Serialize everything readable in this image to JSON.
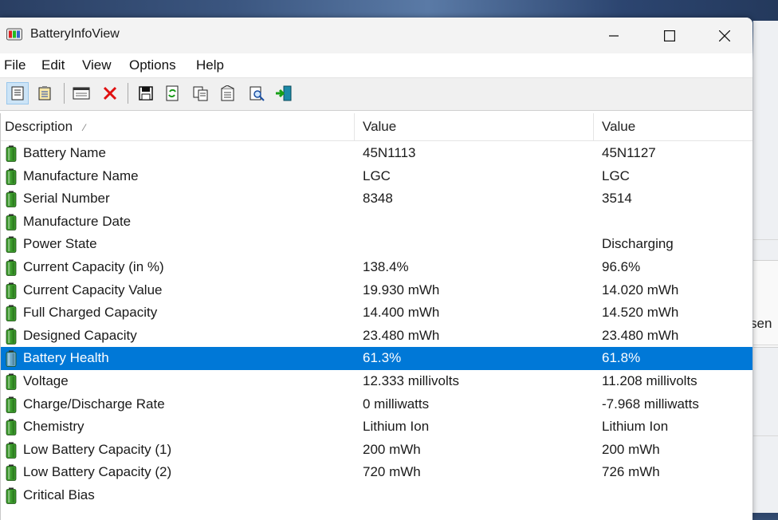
{
  "window": {
    "title": "BatteryInfoView",
    "controls": {
      "minimize": "—",
      "maximize": "☐",
      "close": "✕"
    }
  },
  "menu": [
    "File",
    "Edit",
    "View",
    "Options",
    "Help"
  ],
  "toolbar": [
    "html-report-all-icon",
    "html-report-selected-icon",
    "properties-window-icon",
    "delete-icon",
    "save-icon",
    "refresh-icon",
    "copy-icon",
    "properties-icon",
    "find-icon",
    "exit-icon"
  ],
  "columns": [
    "Description",
    "Value",
    "Value"
  ],
  "sort_indicator": "⁄",
  "rows": [
    {
      "desc": "Battery Name",
      "v1": "45N1113",
      "v2": "45N1127"
    },
    {
      "desc": "Manufacture Name",
      "v1": "LGC",
      "v2": "LGC"
    },
    {
      "desc": "Serial Number",
      "v1": " 8348",
      "v2": " 3514"
    },
    {
      "desc": "Manufacture Date",
      "v1": "",
      "v2": ""
    },
    {
      "desc": "Power State",
      "v1": "",
      "v2": "Discharging"
    },
    {
      "desc": "Current Capacity (in %)",
      "v1": "138.4%",
      "v2": "96.6%"
    },
    {
      "desc": "Current Capacity Value",
      "v1": "19.930 mWh",
      "v2": "14.020 mWh"
    },
    {
      "desc": "Full Charged Capacity",
      "v1": "14.400 mWh",
      "v2": "14.520 mWh"
    },
    {
      "desc": "Designed Capacity",
      "v1": "23.480 mWh",
      "v2": "23.480 mWh"
    },
    {
      "desc": "Battery Health",
      "v1": "61.3%",
      "v2": "61.8%"
    },
    {
      "desc": "Voltage",
      "v1": "12.333 millivolts",
      "v2": "11.208 millivolts"
    },
    {
      "desc": "Charge/Discharge Rate",
      "v1": "0 milliwatts",
      "v2": "-7.968 milliwatts"
    },
    {
      "desc": "Chemistry",
      "v1": "Lithium Ion",
      "v2": "Lithium Ion"
    },
    {
      "desc": "Low Battery Capacity (1)",
      "v1": "200 mWh",
      "v2": "200 mWh"
    },
    {
      "desc": "Low Battery Capacity (2)",
      "v1": "720 mWh",
      "v2": "726 mWh"
    },
    {
      "desc": "Critical Bias",
      "v1": "",
      "v2": ""
    }
  ],
  "selected_row": "Battery Health",
  "background_window_text": "sen",
  "colors": {
    "selection": "#0078d7",
    "battery_green": "#3a9a2a",
    "battery_selected": "#6aa8c8"
  }
}
